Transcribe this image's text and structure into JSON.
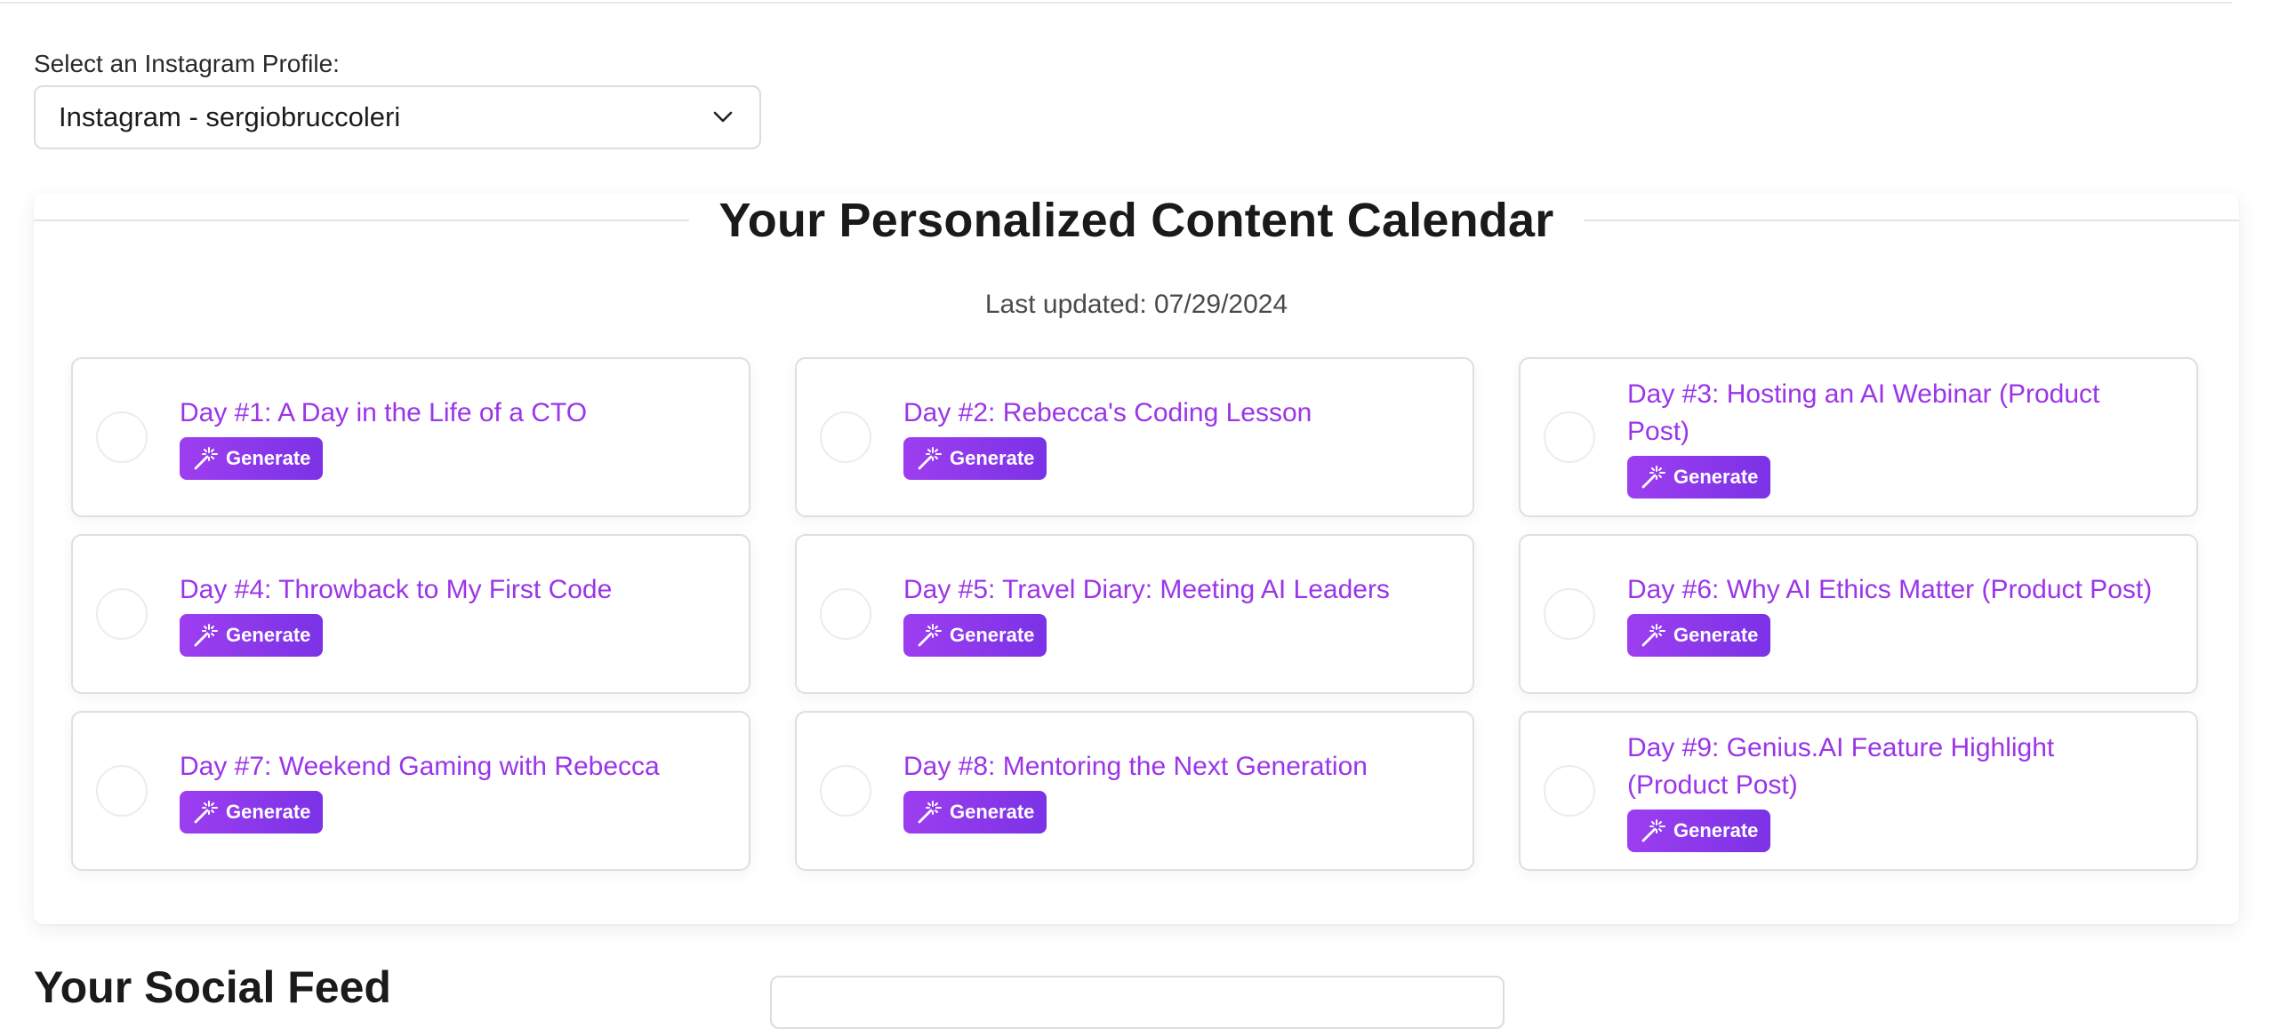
{
  "profile": {
    "label": "Select an Instagram Profile:",
    "selected": "Instagram - sergiobruccoleri"
  },
  "calendar": {
    "title": "Your Personalized Content Calendar",
    "last_updated": "Last updated: 07/29/2024",
    "generate_label": "Generate",
    "days": [
      {
        "title": "Day #1: A Day in the Life of a CTO"
      },
      {
        "title": "Day #2: Rebecca's Coding Lesson"
      },
      {
        "title": "Day #3: Hosting an AI Webinar (Product Post)"
      },
      {
        "title": "Day #4: Throwback to My First Code"
      },
      {
        "title": "Day #5: Travel Diary: Meeting AI Leaders"
      },
      {
        "title": "Day #6: Why AI Ethics Matter (Product Post)"
      },
      {
        "title": "Day #7: Weekend Gaming with Rebecca"
      },
      {
        "title": "Day #8: Mentoring the Next Generation"
      },
      {
        "title": "Day #9: Genius.AI Feature Highlight (Product Post)"
      }
    ]
  },
  "social": {
    "heading": "Your Social Feed"
  },
  "colors": {
    "accent_purple": "#9b35e8",
    "button_gradient_start": "#9d3ef0",
    "button_gradient_end": "#7b32e6"
  },
  "icons": {
    "select_chevron": "chevron-down-icon",
    "generate": "magic-wand-icon"
  }
}
